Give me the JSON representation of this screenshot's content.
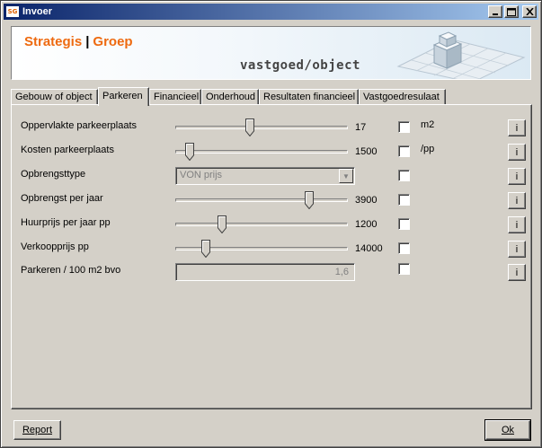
{
  "window": {
    "app_icon": "SG",
    "title": "Invoer",
    "controls": [
      "_",
      "□",
      "✕"
    ]
  },
  "banner": {
    "brand_left": "Strategis",
    "brand_sep": "|",
    "brand_right": "Groep",
    "subtitle": "vastgoed/object",
    "accent_color": "#ee6a10"
  },
  "tabs": [
    {
      "label": "Gebouw of object",
      "active": false
    },
    {
      "label": "Parkeren",
      "active": true
    },
    {
      "label": "Financieel",
      "active": false
    },
    {
      "label": "Onderhoud",
      "active": false
    },
    {
      "label": "Resultaten financieel",
      "active": false
    },
    {
      "label": "Vastgoedresulaat",
      "active": false
    }
  ],
  "rows": [
    {
      "label": "Oppervlakte parkeerplaats",
      "control": "slider",
      "slider_fraction": 0.43,
      "value": "17",
      "checked": false,
      "unit": "m2",
      "info": "i"
    },
    {
      "label": "Kosten parkeerplaats",
      "control": "slider",
      "slider_fraction": 0.06,
      "value": "1500",
      "checked": false,
      "unit": "/pp",
      "info": "i"
    },
    {
      "label": "Opbrengsttype",
      "control": "select",
      "selected": "VON prijs",
      "checked": false,
      "unit": "",
      "info": "i"
    },
    {
      "label": "Opbrengst per jaar",
      "control": "slider",
      "slider_fraction": 0.79,
      "value": "3900",
      "checked": false,
      "unit": "",
      "info": "i"
    },
    {
      "label": "Huurprijs per jaar pp",
      "control": "slider",
      "slider_fraction": 0.26,
      "value": "1200",
      "checked": false,
      "unit": "",
      "info": "i"
    },
    {
      "label": "Verkoopprijs pp",
      "control": "slider",
      "slider_fraction": 0.16,
      "value": "14000",
      "checked": false,
      "unit": "",
      "info": "i"
    },
    {
      "label": "Parkeren / 100 m2 bvo",
      "control": "readonly",
      "value": "1,6",
      "checked": false,
      "unit": "",
      "info": "i"
    }
  ],
  "footer": {
    "report_label": "Report",
    "ok_label": "Ok"
  }
}
